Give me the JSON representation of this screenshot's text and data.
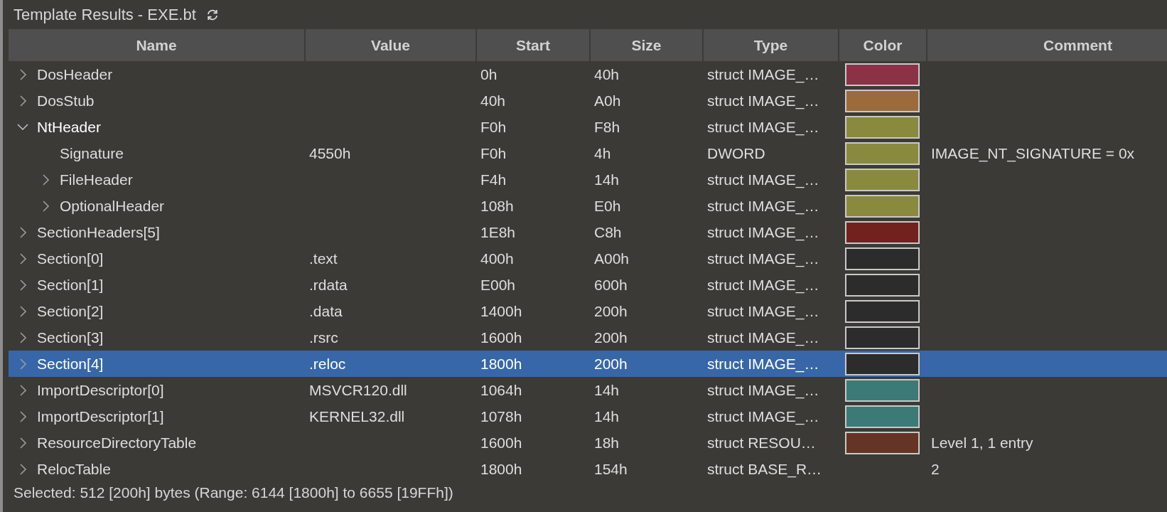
{
  "panel": {
    "title": "Template Results - EXE.bt"
  },
  "table": {
    "columns": [
      "Name",
      "Value",
      "Start",
      "Size",
      "Type",
      "Color",
      "Comment"
    ],
    "rows": [
      {
        "name": "DosHeader",
        "expanded": false,
        "selected": false,
        "start": "0h",
        "size": "40h",
        "type": "struct IMAGE_…",
        "color": "#8c3246"
      },
      {
        "name": "DosStub",
        "expanded": false,
        "selected": false,
        "start": "40h",
        "size": "A0h",
        "type": "struct IMAGE_…",
        "color": "#9c6b3b"
      },
      {
        "name": "NtHeader",
        "expanded": true,
        "selected": false,
        "start": "F0h",
        "size": "F8h",
        "type": "struct IMAGE_…",
        "color": "#8a8a3f",
        "children": [
          {
            "name": "Signature",
            "selected": false,
            "value": "4550h",
            "start": "F0h",
            "size": "4h",
            "type": "DWORD",
            "color": "#8a8a3f",
            "comment": "IMAGE_NT_SIGNATURE = 0x"
          },
          {
            "name": "FileHeader",
            "expanded": false,
            "selected": false,
            "start": "F4h",
            "size": "14h",
            "type": "struct IMAGE_…",
            "color": "#8a8a3f"
          },
          {
            "name": "OptionalHeader",
            "expanded": false,
            "selected": false,
            "start": "108h",
            "size": "E0h",
            "type": "struct IMAGE_…",
            "color": "#8a8a3f"
          }
        ]
      },
      {
        "name": "SectionHeaders[5]",
        "expanded": false,
        "selected": false,
        "start": "1E8h",
        "size": "C8h",
        "type": "struct IMAGE_…",
        "color": "#72211f"
      },
      {
        "name": "Section[0]",
        "expanded": false,
        "selected": false,
        "value": ".text",
        "start": "400h",
        "size": "A00h",
        "type": "struct IMAGE_…",
        "color": "#2c2c2c"
      },
      {
        "name": "Section[1]",
        "expanded": false,
        "selected": false,
        "value": ".rdata",
        "start": "E00h",
        "size": "600h",
        "type": "struct IMAGE_…",
        "color": "#2c2c2c"
      },
      {
        "name": "Section[2]",
        "expanded": false,
        "selected": false,
        "value": ".data",
        "start": "1400h",
        "size": "200h",
        "type": "struct IMAGE_…",
        "color": "#2c2c2c"
      },
      {
        "name": "Section[3]",
        "expanded": false,
        "selected": false,
        "value": ".rsrc",
        "start": "1600h",
        "size": "200h",
        "type": "struct IMAGE_…",
        "color": "#2c2c2c"
      },
      {
        "name": "Section[4]",
        "expanded": false,
        "selected": true,
        "value": ".reloc",
        "start": "1800h",
        "size": "200h",
        "type": "struct IMAGE_…",
        "color": "#2c2c2c"
      },
      {
        "name": "ImportDescriptor[0]",
        "expanded": false,
        "selected": false,
        "value": "MSVCR120.dll",
        "start": "1064h",
        "size": "14h",
        "type": "struct IMAGE_…",
        "color": "#3b7a77"
      },
      {
        "name": "ImportDescriptor[1]",
        "expanded": false,
        "selected": false,
        "value": "KERNEL32.dll",
        "start": "1078h",
        "size": "14h",
        "type": "struct IMAGE_…",
        "color": "#3b7a77"
      },
      {
        "name": "ResourceDirectoryTable",
        "expanded": false,
        "selected": false,
        "start": "1600h",
        "size": "18h",
        "type": "struct RESOU…",
        "color": "#643424",
        "comment": "Level 1, 1 entry"
      },
      {
        "name": "RelocTable",
        "expanded": false,
        "selected": false,
        "start": "1800h",
        "size": "154h",
        "type": "struct BASE_R…",
        "comment": "2"
      }
    ]
  },
  "status_bar": {
    "text": "Selected: 512 [200h] bytes (Range: 6144 [1800h] to 6655 [19FFh])"
  }
}
